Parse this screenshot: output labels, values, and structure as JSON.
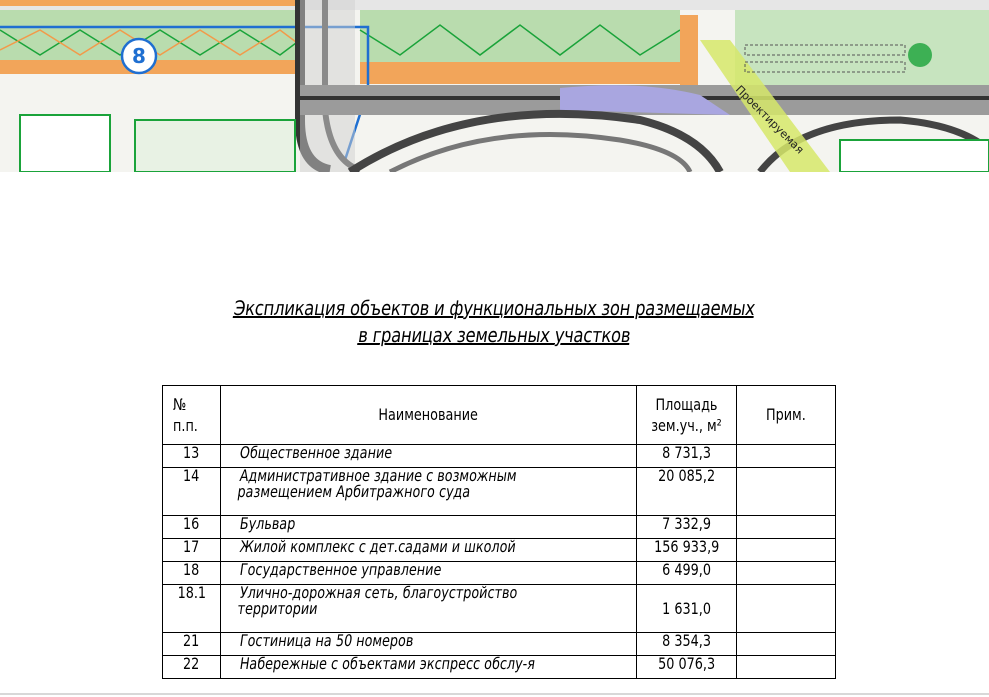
{
  "map": {
    "zone_marker": "8",
    "road_label": "Проектируемая"
  },
  "title": {
    "line1": "Экспликация объектов и функциональных зон размещаемых",
    "line2": "в границах земельных участков"
  },
  "table": {
    "headers": {
      "num_line1": "№",
      "num_line2": "п.п.",
      "name": "Наименование",
      "area_line1": "Площадь",
      "area_line2": "зем.уч., м²",
      "note": "Прим."
    },
    "rows": [
      {
        "num": "13",
        "name": "Общественное здание",
        "area": "8 731,3",
        "note": ""
      },
      {
        "num": "14",
        "name": "Административное здание с возможным\nразмещением Арбитражного суда",
        "area": "20 085,2",
        "note": ""
      },
      {
        "num": "16",
        "name": "Бульвар",
        "area": "7 332,9",
        "note": ""
      },
      {
        "num": "17",
        "name": "Жилой комплекс с дет.садами и школой",
        "area": "156 933,9",
        "note": ""
      },
      {
        "num": "18",
        "name": "Государственное управление",
        "area": "6 499,0",
        "note": ""
      },
      {
        "num": "18.1",
        "name": "Улично-дорожная сеть, благоустройство\nтерритории",
        "area": "1 631,0",
        "note": ""
      },
      {
        "num": "21",
        "name": "Гостиница на 50 номеров",
        "area": "8 354,3",
        "note": ""
      },
      {
        "num": "22",
        "name": "Набережные с объектами экспресс обслу-я",
        "area": "50 076,3",
        "note": ""
      }
    ]
  },
  "colors": {
    "green_zone": "#9dcf8e",
    "green_line": "#1aa33a",
    "orange_zone": "#f2a55a",
    "road_gray": "#bfbfbf",
    "blue_line": "#1f6fd1",
    "purple_zone": "#a9a6e0",
    "yellow_green": "#d6e86a"
  }
}
